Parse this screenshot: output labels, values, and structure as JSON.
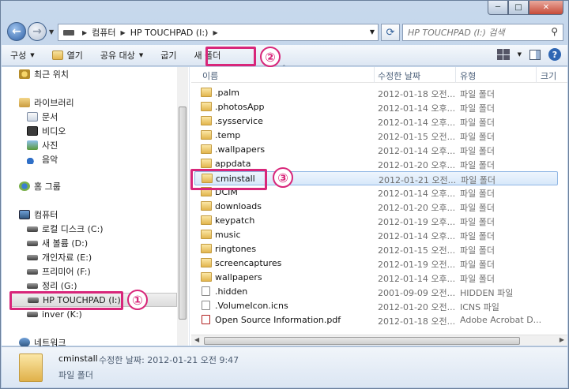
{
  "window": {
    "minimize": "─",
    "maximize": "□",
    "close": "✕"
  },
  "address": {
    "crumbs": [
      "컴퓨터",
      "HP TOUCHPAD (I:)"
    ],
    "search_placeholder": "HP TOUCHPAD (I:) 검색"
  },
  "toolbar": {
    "organize": "구성",
    "open": "열기",
    "share": "공유 대상",
    "burn": "굽기",
    "new_folder": "새 폴더"
  },
  "nav": {
    "favorites": "최근 위치",
    "libraries": "라이브러리",
    "documents": "문서",
    "videos": "비디오",
    "pictures": "사진",
    "music": "음악",
    "homegroup": "홈 그룹",
    "computer": "컴퓨터",
    "drives": [
      "로컬 디스크 (C:)",
      "새 볼륨 (D:)",
      "개인자료 (E:)",
      "프리미어 (F:)",
      "정리 (G:)",
      "HP TOUCHPAD (I:)",
      "inver (K:)"
    ],
    "network": "네트워크"
  },
  "columns": {
    "name": "이름",
    "date": "수정한 날짜",
    "type": "유형",
    "size": "크기"
  },
  "files": [
    {
      "name": ".palm",
      "date": "2012-01-18 오전...",
      "type": "파일 폴더",
      "icon": "folder"
    },
    {
      "name": ".photosApp",
      "date": "2012-01-14 오후...",
      "type": "파일 폴더",
      "icon": "folder"
    },
    {
      "name": ".sysservice",
      "date": "2012-01-14 오후...",
      "type": "파일 폴더",
      "icon": "folder"
    },
    {
      "name": ".temp",
      "date": "2012-01-15 오전...",
      "type": "파일 폴더",
      "icon": "folder"
    },
    {
      "name": ".wallpapers",
      "date": "2012-01-14 오후...",
      "type": "파일 폴더",
      "icon": "folder"
    },
    {
      "name": "appdata",
      "date": "2012-01-20 오후...",
      "type": "파일 폴더",
      "icon": "folder"
    },
    {
      "name": "cminstall",
      "date": "2012-01-21 오전...",
      "type": "파일 폴더",
      "icon": "folder"
    },
    {
      "name": "DCIM",
      "date": "2012-01-14 오후...",
      "type": "파일 폴더",
      "icon": "folder"
    },
    {
      "name": "downloads",
      "date": "2012-01-20 오후...",
      "type": "파일 폴더",
      "icon": "folder"
    },
    {
      "name": "keypatch",
      "date": "2012-01-19 오후...",
      "type": "파일 폴더",
      "icon": "folder"
    },
    {
      "name": "music",
      "date": "2012-01-14 오후...",
      "type": "파일 폴더",
      "icon": "folder"
    },
    {
      "name": "ringtones",
      "date": "2012-01-15 오전...",
      "type": "파일 폴더",
      "icon": "folder"
    },
    {
      "name": "screencaptures",
      "date": "2012-01-19 오전...",
      "type": "파일 폴더",
      "icon": "folder"
    },
    {
      "name": "wallpapers",
      "date": "2012-01-14 오후...",
      "type": "파일 폴더",
      "icon": "folder"
    },
    {
      "name": ".hidden",
      "date": "2001-09-09 오전...",
      "type": "HIDDEN 파일",
      "icon": "file"
    },
    {
      "name": ".VolumeIcon.icns",
      "date": "2012-01-20 오전...",
      "type": "ICNS 파일",
      "icon": "file"
    },
    {
      "name": "Open Source Information.pdf",
      "date": "2012-01-18 오전...",
      "type": "Adobe Acrobat D...",
      "icon": "pdf"
    }
  ],
  "details": {
    "name": "cminstall",
    "modified": "수정한 날짜: 2012-01-21 오전 9:47",
    "type": "파일 폴더"
  },
  "callouts": [
    "①",
    "②",
    "③"
  ],
  "colors": {
    "callout": "#d8267a",
    "selection": "#d7e8fa"
  }
}
